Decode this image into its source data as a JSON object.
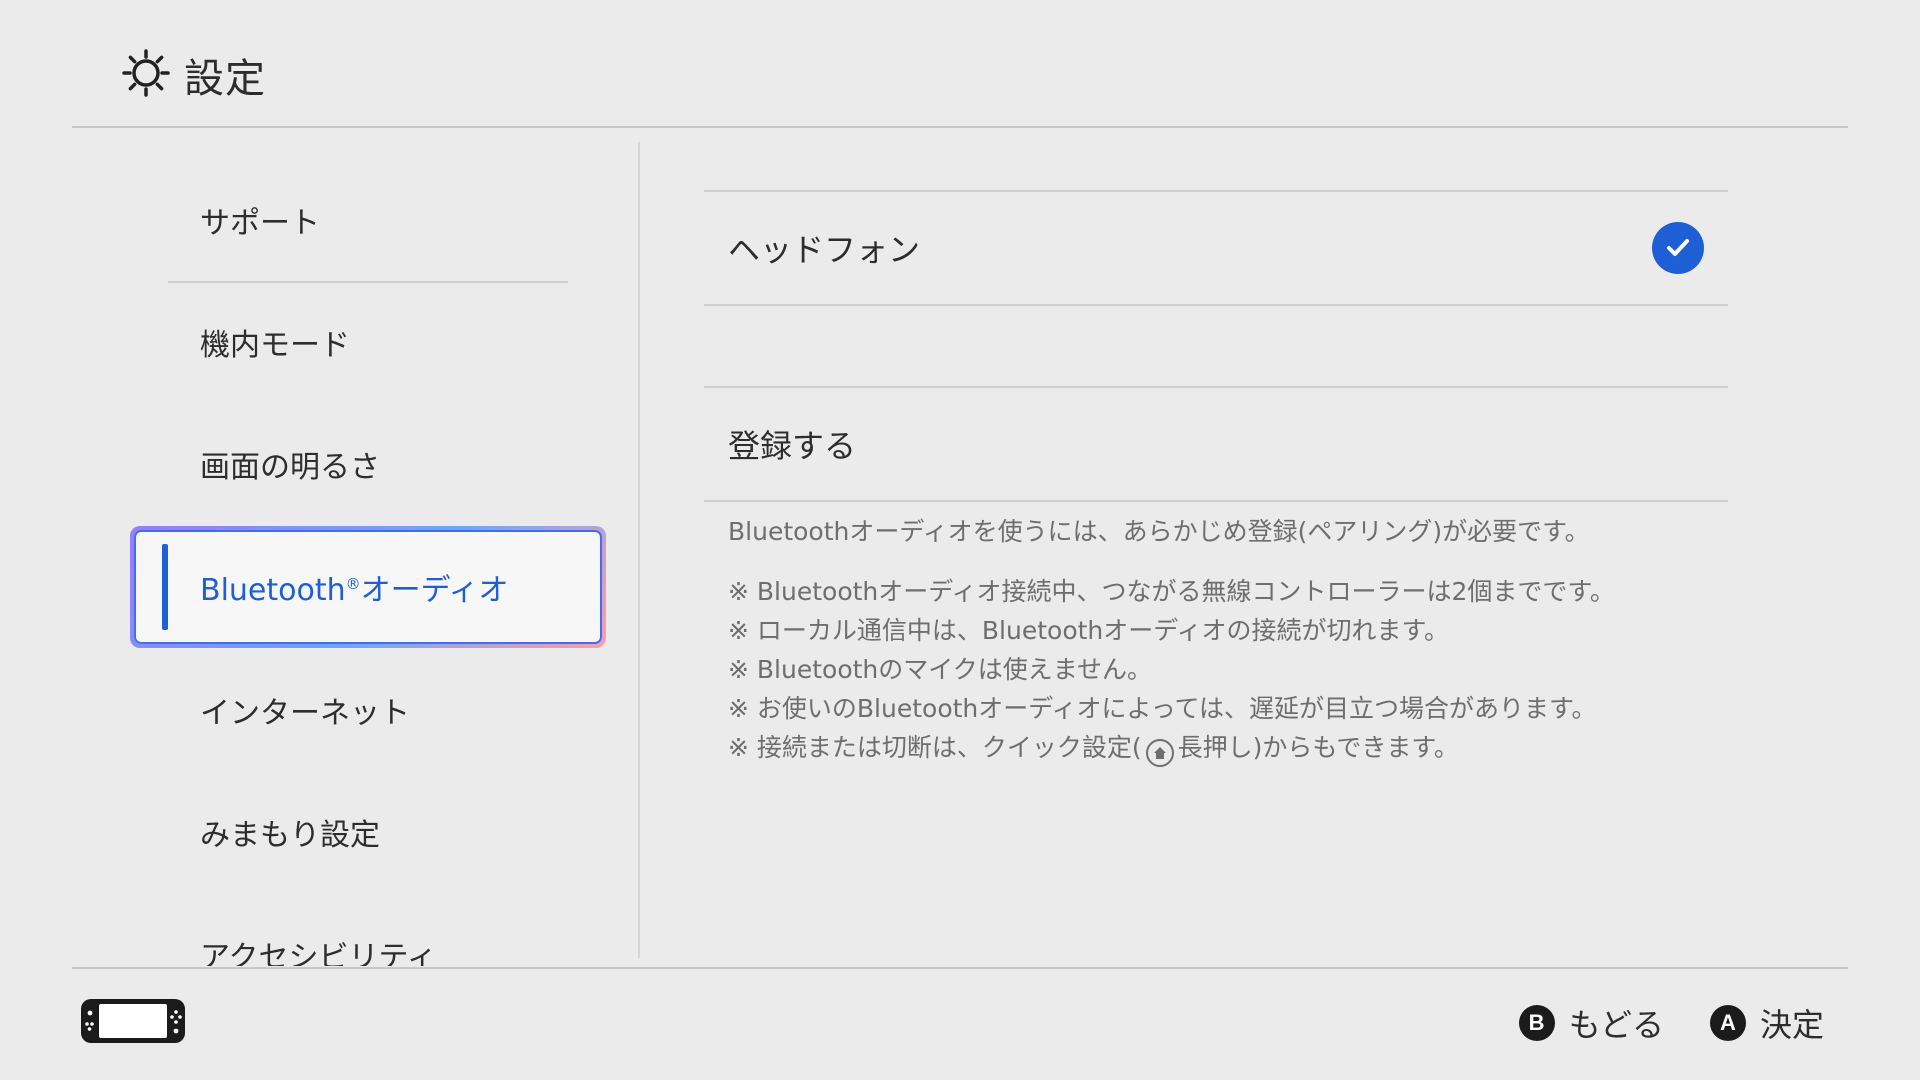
{
  "header": {
    "title": "設定",
    "icon": "gear-icon"
  },
  "sidebar": {
    "items": [
      {
        "label": "サポート"
      },
      {
        "label": "機内モード"
      },
      {
        "label": "画面の明るさ"
      },
      {
        "label": "Bluetooth",
        "sup": "®",
        "suffix": "オーディオ",
        "selected": true
      },
      {
        "label": "インターネット"
      },
      {
        "label": "みまもり設定"
      },
      {
        "label": "アクセシビリティ"
      }
    ]
  },
  "main": {
    "devices": [
      {
        "label": "ヘッドフォン",
        "connected": true
      }
    ],
    "register_label": "登録する",
    "description": "Bluetoothオーディオを使うには、あらかじめ登録(ペアリング)が必要です。",
    "notes": [
      "※ Bluetoothオーディオ接続中、つながる無線コントローラーは2個までです。",
      "※ ローカル通信中は、Bluetoothオーディオの接続が切れます。",
      "※ Bluetoothのマイクは使えません。",
      "※ お使いのBluetoothオーディオによっては、遅延が目立つ場合があります。"
    ],
    "note_last": {
      "before": "※ 接続または切断は、クイック設定(",
      "after": "長押し)からもできます。"
    }
  },
  "footer": {
    "back": {
      "button": "B",
      "label": "もどる"
    },
    "ok": {
      "button": "A",
      "label": "決定"
    }
  },
  "colors": {
    "accent": "#1f5fd6",
    "background": "#ebebeb"
  }
}
